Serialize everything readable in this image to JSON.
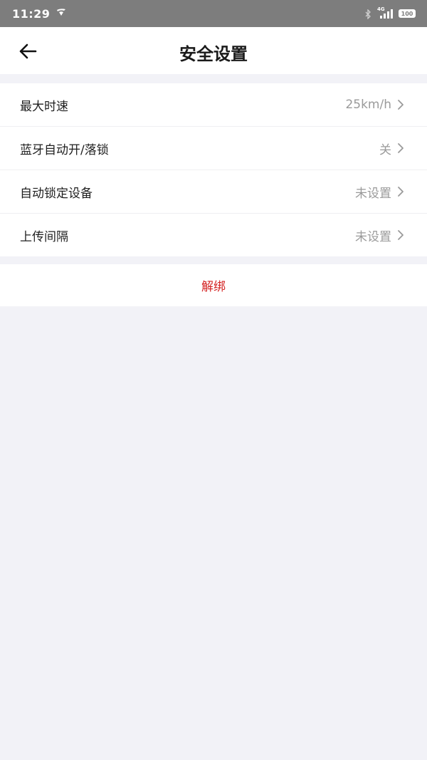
{
  "status_bar": {
    "time": "11:29",
    "network_type": "4G",
    "battery": "100"
  },
  "nav": {
    "title": "安全设置",
    "back_icon": "arrow-left-icon"
  },
  "settings": [
    {
      "label": "最大时速",
      "value": "25km/h"
    },
    {
      "label": "蓝牙自动开/落锁",
      "value": "关"
    },
    {
      "label": "自动锁定设备",
      "value": "未设置"
    },
    {
      "label": "上传间隔",
      "value": "未设置"
    }
  ],
  "actions": {
    "unbind_label": "解绑"
  },
  "colors": {
    "background": "#f2f2f7",
    "danger": "#d42323",
    "status_bar": "#7d7d7d"
  }
}
